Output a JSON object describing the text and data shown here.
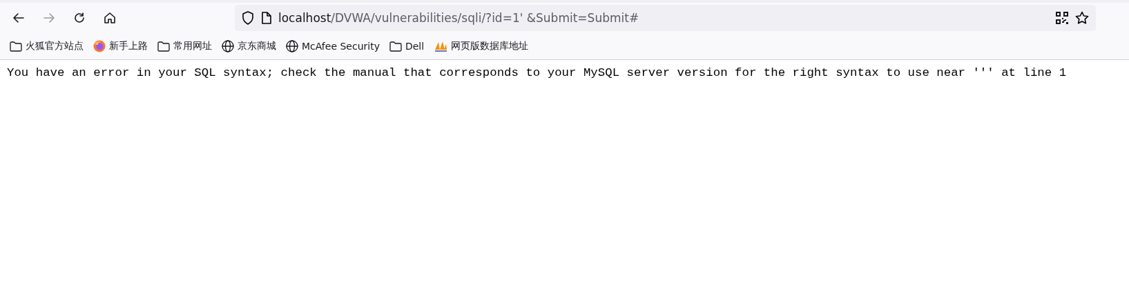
{
  "toolbar": {
    "buttons": [
      {
        "kind": "back",
        "disabled": false
      },
      {
        "kind": "forward",
        "disabled": true
      },
      {
        "kind": "reload",
        "disabled": false
      },
      {
        "kind": "home",
        "disabled": false
      }
    ]
  },
  "address_bar": {
    "host": "localhost",
    "path": "/DVWA/vulnerabilities/sqli/?id=1' &Submit=Submit#"
  },
  "bookmarks": [
    {
      "kind": "folder",
      "label": "火狐官方站点"
    },
    {
      "kind": "firefox",
      "label": "新手上路"
    },
    {
      "kind": "folder",
      "label": "常用网址"
    },
    {
      "kind": "globe",
      "label": "京东商城"
    },
    {
      "kind": "globe",
      "label": "McAfee Security"
    },
    {
      "kind": "folder",
      "label": "Dell"
    },
    {
      "kind": "pma",
      "label": "网页版数据库地址"
    }
  ],
  "page": {
    "message": "You have an error in your SQL syntax; check the manual that corresponds to your MySQL server version for the right syntax to use near ''' at line 1"
  }
}
